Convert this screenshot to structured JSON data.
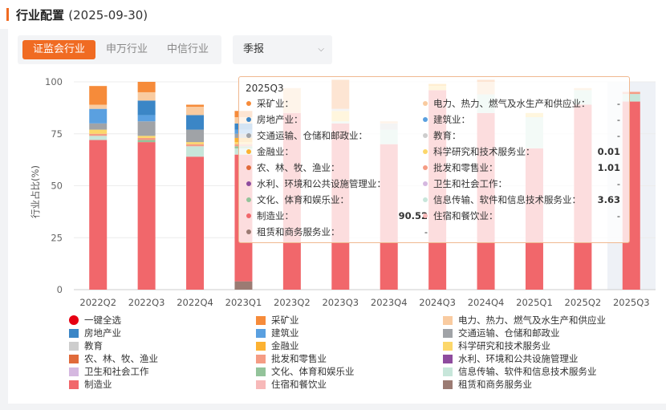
{
  "header": {
    "title": "行业配置",
    "date": "(2025-09-30)"
  },
  "tabs": [
    {
      "label": "证监会行业",
      "active": true
    },
    {
      "label": "申万行业",
      "active": false
    },
    {
      "label": "中信行业",
      "active": false
    }
  ],
  "period_select": {
    "value": "季报"
  },
  "legend_select_all": "一键全选",
  "industries": [
    {
      "name": "采矿业",
      "color": "#f68b3a"
    },
    {
      "name": "电力、热力、燃气及水生产和供应业",
      "color": "#f9cba0"
    },
    {
      "name": "房地产业",
      "color": "#3b86c6"
    },
    {
      "name": "建筑业",
      "color": "#5aa0e0"
    },
    {
      "name": "交通运输、仓储和邮政业",
      "color": "#a0a3a7"
    },
    {
      "name": "教育",
      "color": "#cdcdcd"
    },
    {
      "name": "金融业",
      "color": "#fcb232"
    },
    {
      "name": "科学研究和技术服务业",
      "color": "#fcd76a"
    },
    {
      "name": "农、林、牧、渔业",
      "color": "#e06a3a"
    },
    {
      "name": "批发和零售业",
      "color": "#f59c84"
    },
    {
      "name": "水利、环境和公共设施管理业",
      "color": "#8e4c9e"
    },
    {
      "name": "卫生和社会工作",
      "color": "#d5b8e0"
    },
    {
      "name": "文化、体育和娱乐业",
      "color": "#93c39a"
    },
    {
      "name": "信息传输、软件和信息技术服务业",
      "color": "#c7e6da"
    },
    {
      "name": "制造业",
      "color": "#f1676b"
    },
    {
      "name": "住宿和餐饮业",
      "color": "#f7b9b9"
    },
    {
      "name": "租赁和商务服务业",
      "color": "#9b7b73"
    }
  ],
  "tooltip": {
    "title": "2025Q3",
    "left": [
      {
        "name": "采矿业",
        "value": "-",
        "color": "#f68b3a",
        "bold": false
      },
      {
        "name": "房地产业",
        "value": "-",
        "color": "#3b86c6",
        "bold": false
      },
      {
        "name": "交通运输、仓储和邮政业",
        "value": "-",
        "color": "#a0a3a7",
        "bold": false
      },
      {
        "name": "金融业",
        "value": "-",
        "color": "#fcb232",
        "bold": false
      },
      {
        "name": "农、林、牧、渔业",
        "value": "-",
        "color": "#e06a3a",
        "bold": false
      },
      {
        "name": "水利、环境和公共设施管理业",
        "value": "-",
        "color": "#8e4c9e",
        "bold": false
      },
      {
        "name": "文化、体育和娱乐业",
        "value": "-",
        "color": "#93c39a",
        "bold": false
      },
      {
        "name": "制造业",
        "value": "90.52",
        "color": "#f1676b",
        "bold": true
      },
      {
        "name": "租赁和商务服务业",
        "value": "-",
        "color": "#9b7b73",
        "bold": false
      }
    ],
    "right": [
      {
        "name": "电力、热力、燃气及水生产和供应业",
        "value": "-",
        "color": "#f9cba0",
        "bold": false
      },
      {
        "name": "建筑业",
        "value": "-",
        "color": "#5aa0e0",
        "bold": false
      },
      {
        "name": "教育",
        "value": "-",
        "color": "#cdcdcd",
        "bold": false
      },
      {
        "name": "科学研究和技术服务业",
        "value": "0.01",
        "color": "#fcd76a",
        "bold": true
      },
      {
        "name": "批发和零售业",
        "value": "1.01",
        "color": "#f59c84",
        "bold": true
      },
      {
        "name": "卫生和社会工作",
        "value": "-",
        "color": "#d5b8e0",
        "bold": false
      },
      {
        "name": "信息传输、软件和信息技术服务业",
        "value": "3.63",
        "color": "#c7e6da",
        "bold": true
      },
      {
        "name": "住宿和餐饮业",
        "value": "-",
        "color": "#f7b9b9",
        "bold": false
      }
    ]
  },
  "chart_data": {
    "type": "bar",
    "stacked": true,
    "ylabel": "行业占比(%)",
    "ylim": [
      0,
      100
    ],
    "yticks": [
      "0",
      "25",
      "50",
      "75",
      "100"
    ],
    "categories": [
      "2022Q2",
      "2022Q3",
      "2022Q4",
      "2023Q1",
      "2023Q2",
      "2023Q3",
      "2023Q4",
      "2024Q3",
      "2024Q4",
      "2025Q1",
      "2025Q2",
      "2025Q3"
    ],
    "highlighted_category": "2025Q3",
    "series": [
      {
        "name": "租赁和商务服务业",
        "values": [
          0,
          0,
          0,
          4,
          0,
          0,
          0,
          0,
          0,
          0,
          0,
          0
        ]
      },
      {
        "name": "制造业",
        "values": [
          72,
          71,
          64,
          61,
          85,
          80,
          70,
          96,
          85,
          68,
          89,
          90.52
        ]
      },
      {
        "name": "信息传输、软件和信息技术服务业",
        "values": [
          2,
          0,
          5,
          3,
          0,
          1,
          7,
          0,
          9,
          15,
          7,
          3.63
        ]
      },
      {
        "name": "文化、体育和娱乐业",
        "values": [
          0,
          1,
          0,
          1,
          0,
          0,
          0,
          0,
          0,
          0,
          0,
          0
        ]
      },
      {
        "name": "批发和零售业",
        "values": [
          1,
          1,
          1,
          1,
          0,
          0,
          0,
          0,
          0,
          0,
          0,
          1.01
        ]
      },
      {
        "name": "科学研究和技术服务业",
        "values": [
          2,
          1,
          1,
          1,
          0,
          5,
          0,
          2,
          0,
          2,
          0,
          0.01
        ]
      },
      {
        "name": "金融业",
        "values": [
          0,
          0,
          0,
          2,
          0,
          0,
          0,
          1,
          0,
          0,
          0,
          0
        ]
      },
      {
        "name": "教育",
        "values": [
          0,
          0,
          0,
          0,
          0,
          1,
          3,
          0,
          0,
          0,
          0,
          0
        ]
      },
      {
        "name": "交通运输、仓储和邮政业",
        "values": [
          3,
          7,
          6,
          2,
          0,
          0,
          0,
          0,
          0,
          0,
          0,
          0
        ]
      },
      {
        "name": "建筑业",
        "values": [
          7,
          3,
          0,
          2,
          0,
          0,
          0,
          0,
          0,
          0,
          0,
          0
        ]
      },
      {
        "name": "房地产业",
        "values": [
          0,
          7,
          7,
          3,
          0,
          0,
          0,
          0,
          0,
          0,
          0,
          0
        ]
      },
      {
        "name": "电力、热力、燃气及水生产和供应业",
        "values": [
          2,
          4,
          4,
          3,
          12,
          0,
          1,
          0,
          6,
          0,
          1,
          0
        ]
      },
      {
        "name": "采矿业",
        "values": [
          9,
          5,
          1,
          3,
          0,
          14,
          0,
          0,
          1,
          0,
          0,
          0
        ]
      }
    ]
  }
}
